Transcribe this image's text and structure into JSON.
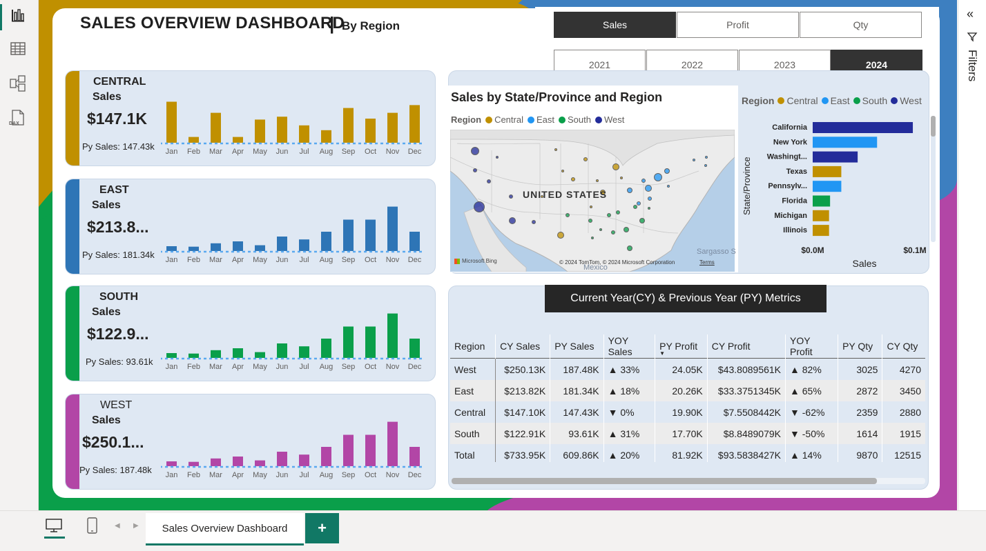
{
  "header": {
    "title": "SALES OVERVIEW DASHBOARD",
    "separator": "|",
    "subtitle": "By Region"
  },
  "metric_buttons": [
    {
      "label": "Sales",
      "selected": true
    },
    {
      "label": "Profit",
      "selected": false
    },
    {
      "label": "Qty",
      "selected": false
    }
  ],
  "year_buttons": [
    {
      "label": "2021",
      "selected": false
    },
    {
      "label": "2022",
      "selected": false
    },
    {
      "label": "2023",
      "selected": false
    },
    {
      "label": "2024",
      "selected": true
    }
  ],
  "months": [
    "Jan",
    "Feb",
    "Mar",
    "Apr",
    "May",
    "Jun",
    "Jul",
    "Aug",
    "Sep",
    "Oct",
    "Nov",
    "Dec"
  ],
  "region_cards": [
    {
      "name": "CENTRAL",
      "sales_label": "Sales",
      "value": "$147.1K",
      "py": "Py Sales: 147.43k",
      "color": "#c09000",
      "chart_data": {
        "type": "bar",
        "values": [
          0.85,
          0.12,
          0.62,
          0.12,
          0.48,
          0.54,
          0.36,
          0.26,
          0.72,
          0.5,
          0.62,
          0.78
        ]
      }
    },
    {
      "name": "EAST",
      "sales_label": "Sales",
      "value": "$213.8...",
      "py": "Py Sales: 181.34k",
      "color": "#2e75b6",
      "chart_data": {
        "type": "bar",
        "values": [
          0.1,
          0.09,
          0.16,
          0.2,
          0.12,
          0.3,
          0.24,
          0.4,
          0.65,
          0.65,
          0.92,
          0.4
        ]
      }
    },
    {
      "name": "SOUTH",
      "sales_label": "Sales",
      "value": "$122.9...",
      "py": "Py Sales: 93.61k",
      "color": "#0a9f4a",
      "chart_data": {
        "type": "bar",
        "values": [
          0.1,
          0.09,
          0.16,
          0.2,
          0.12,
          0.3,
          0.24,
          0.4,
          0.65,
          0.65,
          0.92,
          0.4
        ]
      }
    },
    {
      "name": "WEST",
      "sales_label": "Sales",
      "value": "$250.1...",
      "py": "Py Sales: 187.48k",
      "color": "#b246a6",
      "chart_data": {
        "type": "bar",
        "values": [
          0.1,
          0.09,
          0.16,
          0.2,
          0.12,
          0.3,
          0.24,
          0.4,
          0.65,
          0.65,
          0.92,
          0.4
        ]
      }
    }
  ],
  "map": {
    "title": "Sales by State/Province and Region",
    "legend_title": "Region",
    "legend": [
      {
        "name": "Central",
        "color": "#c09000"
      },
      {
        "name": "East",
        "color": "#2196f3"
      },
      {
        "name": "South",
        "color": "#0a9f4a"
      },
      {
        "name": "West",
        "color": "#232c9a"
      }
    ],
    "country_label": "UNITED STATES",
    "sea_label": "Sargasso S",
    "mexico_label": "Mexico",
    "attribution": "© 2024 TomTom, © 2024 Microsoft Corporation",
    "terms": "Terms",
    "bing": "Microsoft Bing"
  },
  "bar_chart": {
    "legend_title": "Region",
    "legend": [
      {
        "name": "Central",
        "color": "#c09000"
      },
      {
        "name": "East",
        "color": "#2196f3"
      },
      {
        "name": "South",
        "color": "#0a9f4a"
      },
      {
        "name": "West",
        "color": "#232c9a"
      }
    ],
    "ylabel": "State/Province",
    "xlabel": "Sales",
    "x_ticks": [
      "$0.0M",
      "$0.1M"
    ],
    "chart_data": {
      "type": "bar",
      "orientation": "horizontal",
      "categories": [
        "California",
        "New York",
        "Washingt...",
        "Texas",
        "Pennsylv...",
        "Florida",
        "Michigan",
        "Illinois"
      ],
      "values": [
        0.098,
        0.063,
        0.044,
        0.028,
        0.028,
        0.017,
        0.016,
        0.016
      ],
      "colors": [
        "#232c9a",
        "#2196f3",
        "#232c9a",
        "#c09000",
        "#2196f3",
        "#0a9f4a",
        "#c09000",
        "#c09000"
      ],
      "xlim": [
        0,
        0.11
      ]
    }
  },
  "metrics_table": {
    "title": "Current Year(CY) & Previous Year (PY) Metrics",
    "columns": [
      "Region",
      "CY Sales",
      "PY Sales",
      "YOY Sales",
      "PY Profit",
      "CY Profit",
      "YOY Profit",
      "PY Qty",
      "CY Qty"
    ],
    "rows": [
      [
        "West",
        "$250.13K",
        "187.48K",
        "▲ 33%",
        "24.05K",
        "$43.8089561K",
        "▲ 82%",
        "3025",
        "4270"
      ],
      [
        "East",
        "$213.82K",
        "181.34K",
        "▲ 18%",
        "20.26K",
        "$33.3751345K",
        "▲ 65%",
        "2872",
        "3450"
      ],
      [
        "Central",
        "$147.10K",
        "147.43K",
        "▼ 0%",
        "19.90K",
        "$7.5508442K",
        "▼ -62%",
        "2359",
        "2880"
      ],
      [
        "South",
        "$122.91K",
        "93.61K",
        "▲ 31%",
        "17.70K",
        "$8.8489079K",
        "▼ -50%",
        "1614",
        "1915"
      ],
      [
        "Total",
        "$733.95K",
        "609.86K",
        "▲ 20%",
        "81.92K",
        "$93.5838427K",
        "▲ 14%",
        "9870",
        "12515"
      ]
    ]
  },
  "filters": {
    "label": "Filters"
  },
  "bottom": {
    "page_tab": "Sales Overview Dashboard",
    "add_label": "+"
  }
}
